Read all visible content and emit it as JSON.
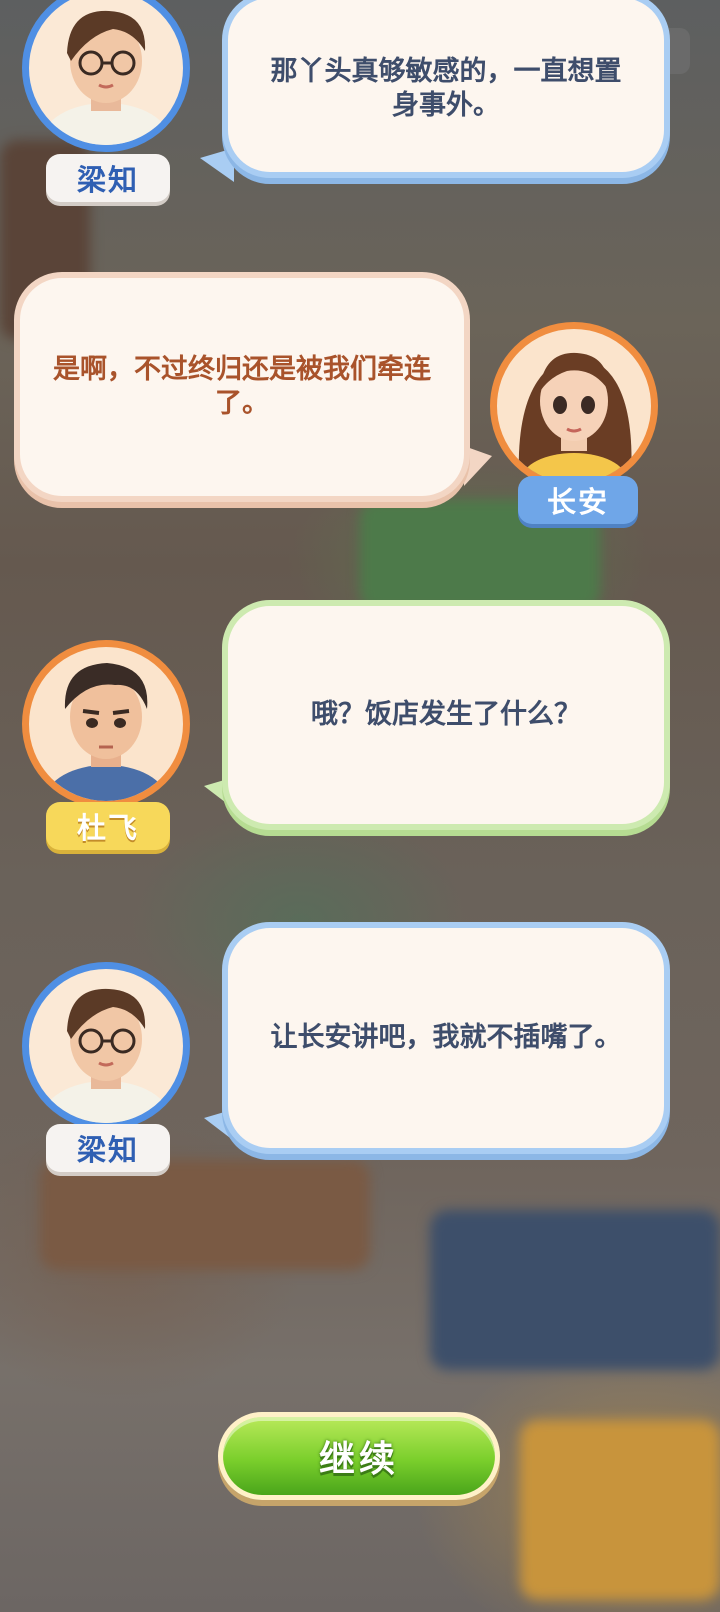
{
  "dialogue": [
    {
      "speaker": "梁知",
      "text": "那丫头真够敏感的，一直想置身事外。",
      "side": "left",
      "bubble_color": "blue",
      "avatar_ring": "#4f8fe4",
      "avatar_icon": "man-with-glasses-portrait"
    },
    {
      "speaker": "长安",
      "text": "是啊，不过终归还是被我们牵连了。",
      "side": "right",
      "bubble_color": "peach",
      "avatar_ring": "#f08d3f",
      "avatar_icon": "long-haired-woman-portrait"
    },
    {
      "speaker": "杜飞",
      "text": "哦？饭店发生了什么？",
      "side": "left",
      "bubble_color": "green",
      "avatar_ring": "#f08d3f",
      "avatar_icon": "short-haired-man-portrait"
    },
    {
      "speaker": "梁知",
      "text": "让长安讲吧，我就不插嘴了。",
      "side": "left",
      "bubble_color": "blue",
      "avatar_ring": "#4f8fe4",
      "avatar_icon": "man-with-glasses-portrait"
    }
  ],
  "continue_button": {
    "label": "继续",
    "color": "#7bcf2c"
  }
}
